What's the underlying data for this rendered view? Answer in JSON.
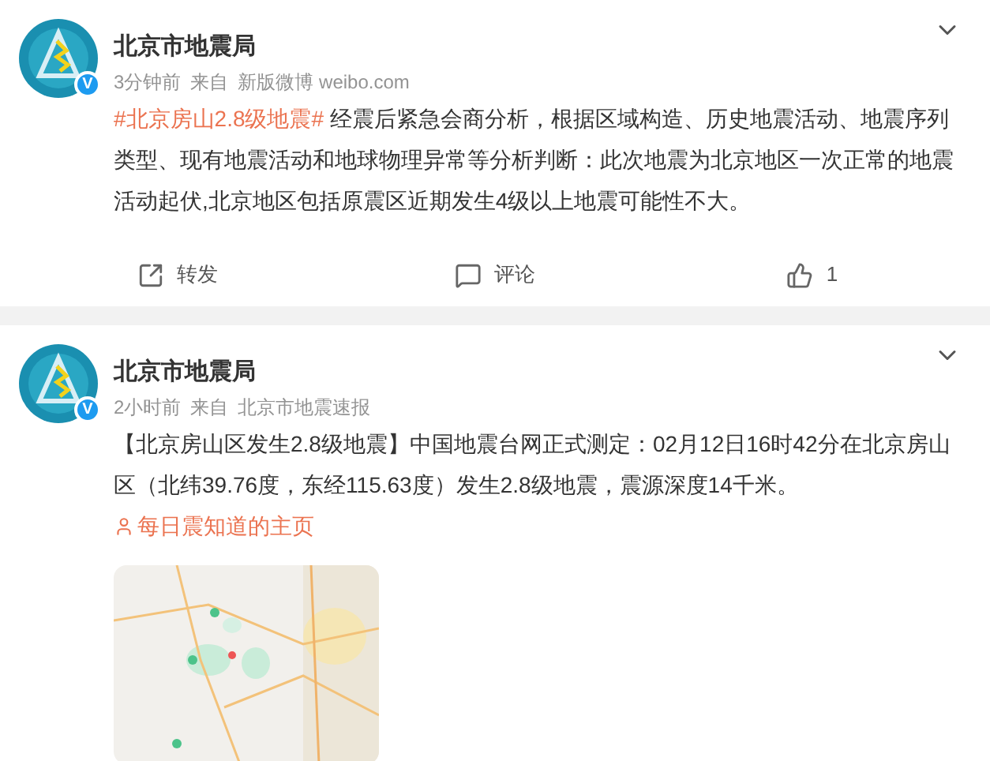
{
  "posts": [
    {
      "author": "北京市地震局",
      "badge": "V",
      "time": "3分钟前",
      "source_label": "来自",
      "source": "新版微博 weibo.com",
      "text": [
        {
          "kind": "hashtag",
          "text": "#北京房山2.8级地震#"
        },
        {
          "kind": "text",
          "text": " 经震后紧急会商分析，根据区域构造、历史地震活动、地震序列类型、现有地震活动和地球物理异常等分析判断：此次地震为北京地区一次正常的地震活动起伏,北京地区包括原震区近期发生4级以上地震可能性不大。"
        }
      ],
      "actions": [
        {
          "kind": "repost",
          "label": "转发"
        },
        {
          "kind": "comment",
          "label": "评论"
        },
        {
          "kind": "like",
          "label": "1"
        }
      ]
    },
    {
      "author": "北京市地震局",
      "badge": "V",
      "time": "2小时前",
      "source_label": "来自",
      "source": "北京市地震速报",
      "text": [
        {
          "kind": "text",
          "text": "【北京房山区发生2.8级地震】中国地震台网正式测定：02月12日16时42分在北京房山区（北纬39.76度，东经115.63度）发生2.8级地震，震源深度14千米。"
        },
        {
          "kind": "link",
          "text": "每日震知道的主页"
        }
      ],
      "media": {
        "kind": "picture"
      }
    }
  ]
}
